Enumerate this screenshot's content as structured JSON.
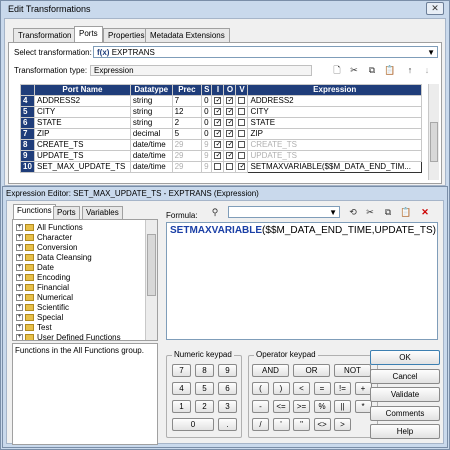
{
  "window": {
    "title": "Edit Transformations"
  },
  "tabs": [
    "Transformation",
    "Ports",
    "Properties",
    "Metadata Extensions"
  ],
  "select_transformation": {
    "label": "Select transformation:",
    "value": "EXPTRANS",
    "icon_glyph": "f(x)"
  },
  "transformation_type": {
    "label": "Transformation type:",
    "value": "Expression"
  },
  "ports_table": {
    "headers": [
      "Port Name",
      "Datatype",
      "Prec",
      "S",
      "I",
      "O",
      "V",
      "Expression"
    ],
    "rows": [
      {
        "num": "4",
        "name": "ADDRESS2",
        "type": "string",
        "prec": "7",
        "s": "0",
        "i": true,
        "o": true,
        "v": false,
        "expr": "ADDRESS2",
        "dim": false
      },
      {
        "num": "5",
        "name": "CITY",
        "type": "string",
        "prec": "12",
        "s": "0",
        "i": true,
        "o": true,
        "v": false,
        "expr": "CITY",
        "dim": false
      },
      {
        "num": "6",
        "name": "STATE",
        "type": "string",
        "prec": "2",
        "s": "0",
        "i": true,
        "o": true,
        "v": false,
        "expr": "STATE",
        "dim": false
      },
      {
        "num": "7",
        "name": "ZIP",
        "type": "decimal",
        "prec": "5",
        "s": "0",
        "i": true,
        "o": true,
        "v": false,
        "expr": "ZIP",
        "dim": false
      },
      {
        "num": "8",
        "name": "CREATE_TS",
        "type": "date/time",
        "prec": "29",
        "s": "9",
        "i": true,
        "o": true,
        "v": false,
        "expr": "CREATE_TS",
        "dim": true
      },
      {
        "num": "9",
        "name": "UPDATE_TS",
        "type": "date/time",
        "prec": "29",
        "s": "9",
        "i": true,
        "o": true,
        "v": false,
        "expr": "UPDATE_TS",
        "dim": true
      },
      {
        "num": "10",
        "name": "SET_MAX_UPDATE_TS",
        "type": "date/time",
        "prec": "29",
        "s": "9",
        "i": false,
        "o": false,
        "v": true,
        "expr": "SETMAXVARIABLE($$M_DATA_END_TIM...",
        "dim": true
      }
    ]
  },
  "editor": {
    "title": "Expression Editor: SET_MAX_UPDATE_TS - EXPTRANS (Expression)",
    "left_tabs": [
      "Functions",
      "Ports",
      "Variables"
    ],
    "formula_label": "Formula:",
    "formula_fn": "SETMAXVARIABLE",
    "formula_rest": "($$M_DATA_END_TIME,UPDATE_TS)",
    "tree_items": [
      "All Functions",
      "Character",
      "Conversion",
      "Data Cleansing",
      "Date",
      "Encoding",
      "Financial",
      "Numerical",
      "Scientific",
      "Special",
      "Test",
      "User Defined Functions"
    ],
    "description": "Functions in the All Functions group.",
    "numeric_keypad": {
      "label": "Numeric keypad",
      "keys": [
        "7",
        "8",
        "9",
        "4",
        "5",
        "6",
        "1",
        "2",
        "3",
        "0",
        "."
      ]
    },
    "operator_keypad": {
      "label": "Operator keypad",
      "keys": [
        "AND",
        "OR",
        "NOT",
        "(",
        ")",
        "<",
        "=",
        "!=",
        "+",
        "-",
        "<=",
        ">=",
        "%",
        "||",
        "*",
        "/",
        "'",
        "\"",
        "<>",
        ">"
      ]
    },
    "actions": [
      "OK",
      "Cancel",
      "Validate",
      "Comments",
      "Help"
    ]
  }
}
